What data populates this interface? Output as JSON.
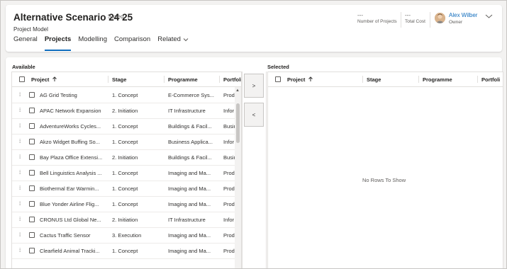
{
  "header": {
    "title": "Alternative Scenario 24 25",
    "saved_status": "- Saved",
    "entity": "Project Model",
    "fields": [
      {
        "value": "---",
        "label": "Number of Projects"
      },
      {
        "value": "---",
        "label": "Total Cost"
      }
    ],
    "owner": {
      "name": "Alex Wilber",
      "label": "Owner"
    }
  },
  "tabs": [
    {
      "label": "General",
      "active": false
    },
    {
      "label": "Projects",
      "active": true
    },
    {
      "label": "Modelling",
      "active": false
    },
    {
      "label": "Comparison",
      "active": false
    },
    {
      "label": "Related",
      "active": false
    }
  ],
  "available": {
    "label": "Available",
    "columns": {
      "project": "Project",
      "sort_icon": "arrow-up-icon",
      "stage": "Stage",
      "programme": "Programme",
      "portfolio": "Portfoli"
    },
    "rows": [
      {
        "project": "AG Grid Testing",
        "stage": "1. Concept",
        "programme": "E-Commerce Sys...",
        "portfolio": "Prod"
      },
      {
        "project": "APAC Network Expansion",
        "stage": "2. Initiation",
        "programme": "IT Infrastructure",
        "portfolio": "Infor"
      },
      {
        "project": "AdventureWorks Cycles...",
        "stage": "1. Concept",
        "programme": "Buildings & Facil...",
        "portfolio": "Busir"
      },
      {
        "project": "Akzo Widget Buffing So...",
        "stage": "1. Concept",
        "programme": "Business Applica...",
        "portfolio": "Infor"
      },
      {
        "project": "Bay Plaza Office Extensi...",
        "stage": "2. Initiation",
        "programme": "Buildings & Facil...",
        "portfolio": "Busir"
      },
      {
        "project": "Bell Linguistics Analysis ...",
        "stage": "1. Concept",
        "programme": "Imaging and Ma...",
        "portfolio": "Prod"
      },
      {
        "project": "Biothermal Ear Warmin...",
        "stage": "1. Concept",
        "programme": "Imaging and Ma...",
        "portfolio": "Prod"
      },
      {
        "project": "Blue Yonder Airline Flig...",
        "stage": "1. Concept",
        "programme": "Imaging and Ma...",
        "portfolio": "Prod"
      },
      {
        "project": "CRONUS Ltd Global Ne...",
        "stage": "2. Initiation",
        "programme": "IT Infrastructure",
        "portfolio": "Infor"
      },
      {
        "project": "Cactus Traffic Sensor",
        "stage": "3. Execution",
        "programme": "Imaging and Ma...",
        "portfolio": "Prod"
      },
      {
        "project": "Clearfield Animal Tracki...",
        "stage": "1. Concept",
        "programme": "Imaging and Ma...",
        "portfolio": "Prod"
      }
    ]
  },
  "buttons": {
    "move_right": ">",
    "move_left": "<"
  },
  "selected": {
    "label": "Selected",
    "columns": {
      "project": "Project",
      "sort_icon": "arrow-up-icon",
      "stage": "Stage",
      "programme": "Programme",
      "portfolio": "Portfoli"
    },
    "empty_message": "No Rows To Show"
  },
  "colors": {
    "accent": "#0f6cbd",
    "page_bg": "#f3f2f1",
    "card_bg": "#ffffff",
    "border": "#e1dfdd"
  }
}
